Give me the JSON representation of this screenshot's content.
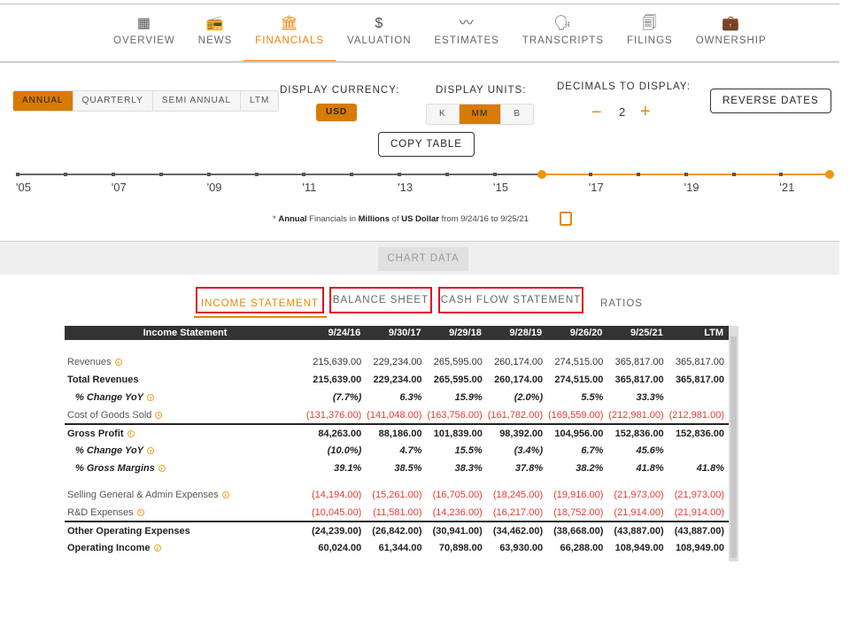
{
  "nav": [
    {
      "label": "OVERVIEW",
      "icon": "building-grid-icon"
    },
    {
      "label": "NEWS",
      "icon": "radio-icon"
    },
    {
      "label": "FINANCIALS",
      "icon": "bank-icon",
      "active": true
    },
    {
      "label": "VALUATION",
      "icon": "dollar-icon"
    },
    {
      "label": "ESTIMATES",
      "icon": "trend-line-icon"
    },
    {
      "label": "TRANSCRIPTS",
      "icon": "speaker-icon"
    },
    {
      "label": "FILINGS",
      "icon": "documents-icon"
    },
    {
      "label": "OWNERSHIP",
      "icon": "briefcase-icon"
    }
  ],
  "period": {
    "options": [
      "ANNUAL",
      "QUARTERLY",
      "SEMI ANNUAL",
      "LTM"
    ],
    "selected": "ANNUAL"
  },
  "currency": {
    "label": "DISPLAY CURRENCY:",
    "value": "USD"
  },
  "units": {
    "label": "DISPLAY UNITS:",
    "options": [
      "K",
      "MM",
      "B"
    ],
    "selected": "MM"
  },
  "decimals": {
    "label": "DECIMALS TO DISPLAY:",
    "value": "2",
    "minus": "−",
    "plus": "+"
  },
  "reverse_dates": "REVERSE DATES",
  "copy_table": "COPY TABLE",
  "timeline": {
    "labels": [
      "'05",
      "'07",
      "'09",
      "'11",
      "'13",
      "'15",
      "'17",
      "'19",
      "'21"
    ],
    "range_start": "2016",
    "range_end": "2022"
  },
  "note": {
    "star": "* ",
    "period": "Annual",
    "t1": " Financials in ",
    "units": "Millions",
    "t2": " of ",
    "currency": "US Dollar",
    "t3": " from 9/24/16 to 9/25/21"
  },
  "chart_data_button": "CHART DATA",
  "tabs": [
    "INCOME STATEMENT",
    "BALANCE SHEET",
    "CASH FLOW STATEMENT",
    "RATIOS"
  ],
  "accent": "#e8860c",
  "table": {
    "headers": [
      "Income Statement",
      "9/24/16",
      "9/30/17",
      "9/29/18",
      "9/28/19",
      "9/26/20",
      "9/25/21",
      "LTM"
    ],
    "rows": [
      {
        "label": "Revenues",
        "style": "",
        "info": true,
        "values": [
          "215,639.00",
          "229,234.00",
          "265,595.00",
          "260,174.00",
          "274,515.00",
          "365,817.00",
          "365,817.00"
        ]
      },
      {
        "label": "Total Revenues",
        "style": "b",
        "values": [
          "215,639.00",
          "229,234.00",
          "265,595.00",
          "260,174.00",
          "274,515.00",
          "365,817.00",
          "365,817.00"
        ]
      },
      {
        "label": "% Change YoY",
        "style": "i",
        "info": true,
        "values": [
          "(7.7%)",
          "6.3%",
          "15.9%",
          "(2.0%)",
          "5.5%",
          "33.3%",
          ""
        ]
      },
      {
        "label": "Cost of Goods Sold",
        "style": "",
        "info": true,
        "values": [
          "(131,376.00)",
          "(141,048.00)",
          "(163,756.00)",
          "(161,782.00)",
          "(169,559.00)",
          "(212,981.00)",
          "(212,981.00)"
        ]
      },
      {
        "label": "Gross Profit",
        "style": "b top",
        "info": true,
        "values": [
          "84,263.00",
          "88,186.00",
          "101,839.00",
          "98,392.00",
          "104,956.00",
          "152,836.00",
          "152,836.00"
        ]
      },
      {
        "label": "% Change YoY",
        "style": "i",
        "info": true,
        "values": [
          "(10.0%)",
          "4.7%",
          "15.5%",
          "(3.4%)",
          "6.7%",
          "45.6%",
          ""
        ]
      },
      {
        "label": "% Gross Margins",
        "style": "i",
        "info": true,
        "values": [
          "39.1%",
          "38.5%",
          "38.3%",
          "37.8%",
          "38.2%",
          "41.8%",
          "41.8%"
        ]
      },
      {
        "label": "Selling General & Admin Expenses",
        "style": "gap",
        "info": true,
        "values": [
          "(14,194.00)",
          "(15,261.00)",
          "(16,705.00)",
          "(18,245.00)",
          "(19,916.00)",
          "(21,973.00)",
          "(21,973.00)"
        ]
      },
      {
        "label": "R&D Expenses",
        "style": "",
        "info": true,
        "values": [
          "(10,045.00)",
          "(11,581.00)",
          "(14,236.00)",
          "(16,217.00)",
          "(18,752.00)",
          "(21,914.00)",
          "(21,914.00)"
        ]
      },
      {
        "label": "Other Operating Expenses",
        "style": "b top",
        "values": [
          "(24,239.00)",
          "(26,842.00)",
          "(30,941.00)",
          "(34,462.00)",
          "(38,668.00)",
          "(43,887.00)",
          "(43,887.00)"
        ]
      },
      {
        "label": "Operating Income",
        "style": "b",
        "info": true,
        "values": [
          "60,024.00",
          "61,344.00",
          "70,898.00",
          "63,930.00",
          "66,288.00",
          "108,949.00",
          "108,949.00"
        ]
      }
    ]
  }
}
